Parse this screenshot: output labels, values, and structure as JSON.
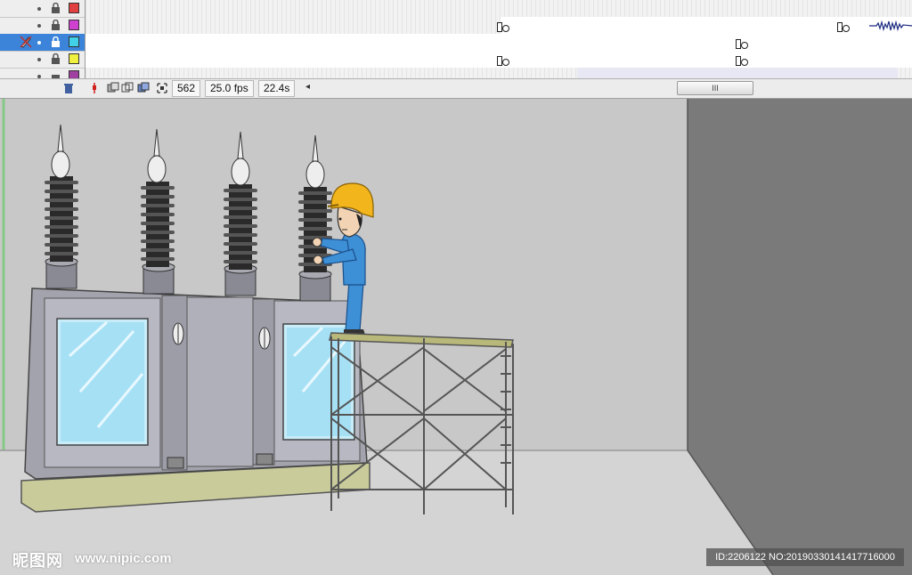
{
  "timeline": {
    "layers": [
      {
        "swatch_color": "#e04040",
        "selected": false
      },
      {
        "swatch_color": "#d040d0",
        "selected": false
      },
      {
        "swatch_color": "#40d0e8",
        "selected": true
      },
      {
        "swatch_color": "#f0f040",
        "selected": false
      },
      {
        "swatch_color": "#a040a0",
        "selected": false
      }
    ],
    "current_frame": "562",
    "frame_rate": "25.0 fps",
    "elapsed_time": "22.4s",
    "scroll_thumb": "III"
  },
  "stage": {
    "wall_color": "#c8c8c8",
    "floor_color": "#d4d4d4",
    "side_wall_color": "#7a7a7a",
    "helmet_color": "#f2b51c",
    "uniform_color": "#3d8fd6"
  },
  "watermark": {
    "logo": "昵图网",
    "url": "www.nipic.com",
    "id": "ID:2206122 NO:20190330141417716000"
  }
}
